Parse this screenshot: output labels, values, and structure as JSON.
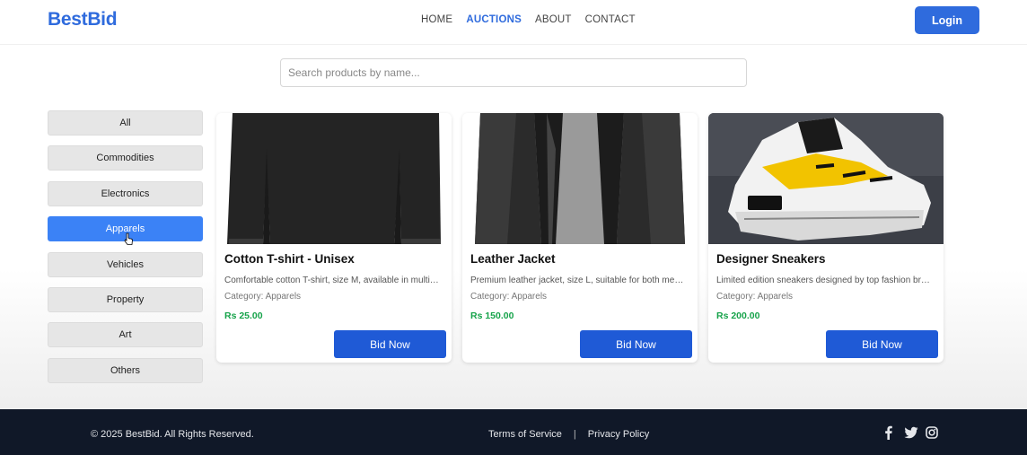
{
  "header": {
    "logo": "BestBid",
    "nav": [
      "HOME",
      "AUCTIONS",
      "ABOUT",
      "CONTACT"
    ],
    "active_nav": "AUCTIONS",
    "login_label": "Login"
  },
  "search": {
    "placeholder": "Search products by name..."
  },
  "categories": [
    "All",
    "Commodities",
    "Electronics",
    "Apparels",
    "Vehicles",
    "Property",
    "Art",
    "Others"
  ],
  "active_category": "Apparels",
  "products": [
    {
      "image_icon": "black-tshirt-image",
      "title": "Cotton T-shirt - Unisex",
      "description": "Comfortable cotton T-shirt, size M, available in multiple colors",
      "category": "Category: Apparels",
      "price": "Rs 25.00",
      "bid_label": "Bid Now"
    },
    {
      "image_icon": "leather-jacket-image",
      "title": "Leather Jacket",
      "description": "Premium leather jacket, size L, suitable for both men and women",
      "category": "Category: Apparels",
      "price": "Rs 150.00",
      "bid_label": "Bid Now"
    },
    {
      "image_icon": "sneaker-image",
      "title": "Designer Sneakers",
      "description": "Limited edition sneakers designed by top fashion brands",
      "category": "Category: Apparels",
      "price": "Rs 200.00",
      "bid_label": "Bid Now"
    }
  ],
  "footer": {
    "copyright": "© 2025 BestBid. All Rights Reserved.",
    "links": [
      "Terms of Service",
      "Privacy Policy"
    ],
    "separator": "|",
    "social_icons": [
      "facebook-icon",
      "twitter-icon",
      "instagram-icon"
    ]
  },
  "colors": {
    "brand": "#2f6bdd",
    "active_category": "#3b82f6",
    "bid_button": "#1f5ad6",
    "price": "#16a34a",
    "footer_bg": "#101828"
  }
}
